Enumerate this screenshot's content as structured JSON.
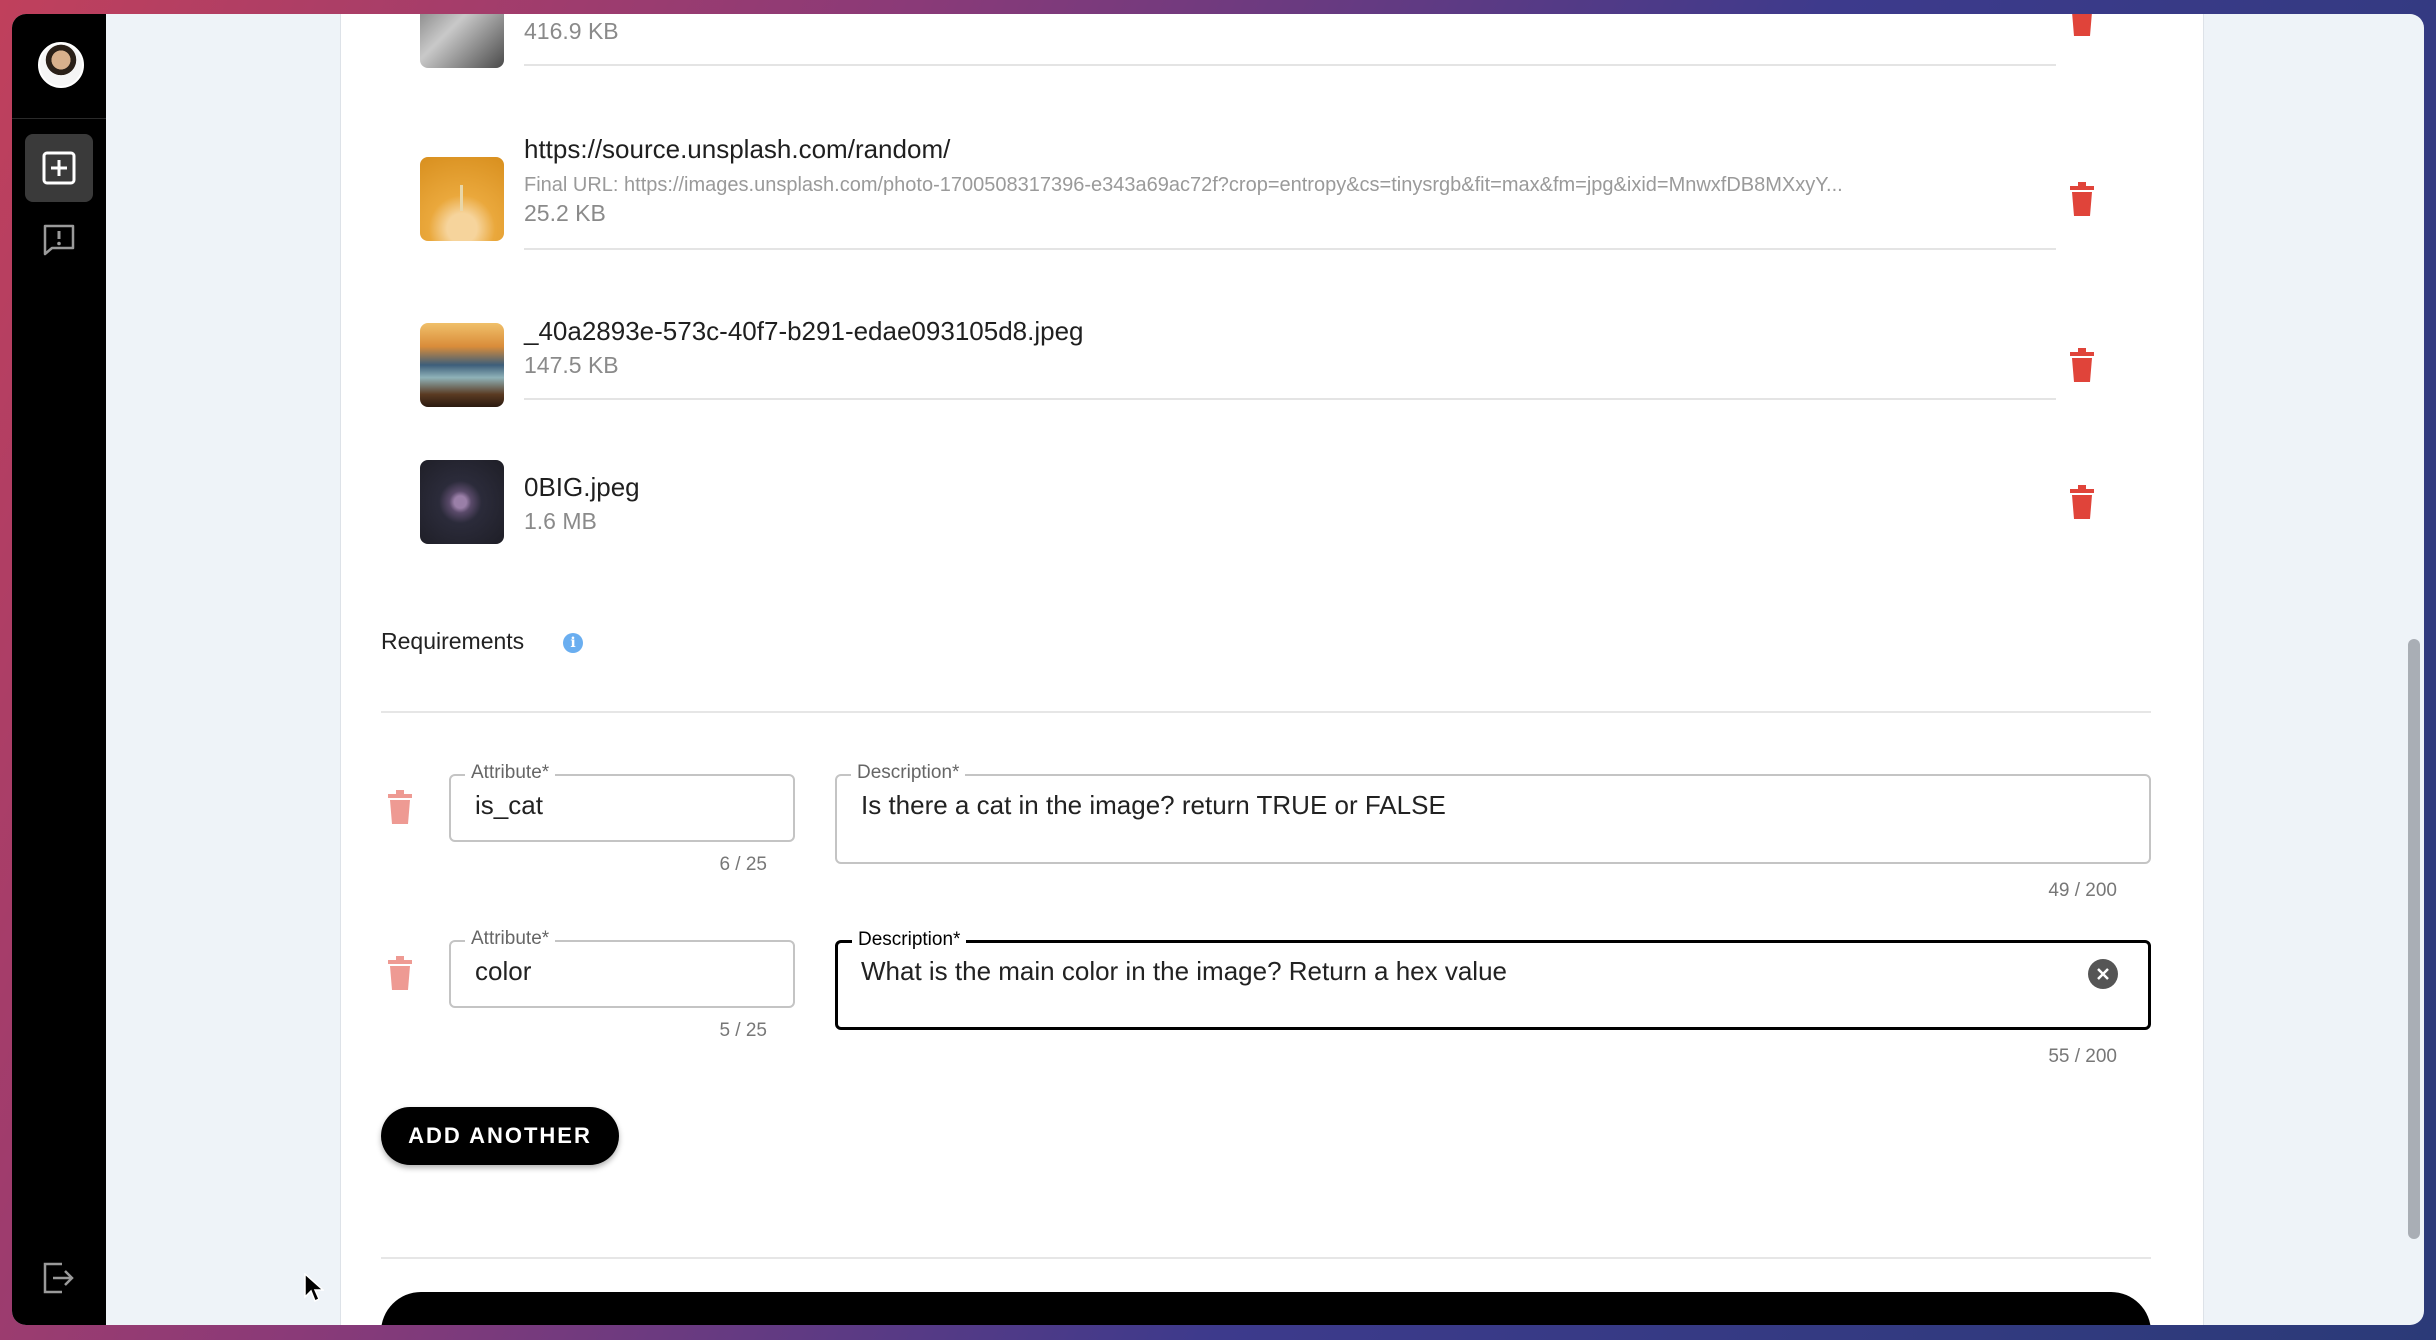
{
  "files": [
    {
      "name": "",
      "size": "416.9 KB"
    },
    {
      "name": "https://source.unsplash.com/random/",
      "final_url": "Final URL: https://images.unsplash.com/photo-1700508317396-e343a69ac72f?crop=entropy&cs=tinysrgb&fit=max&fm=jpg&ixid=MnwxfDB8MXxyY...",
      "size": "25.2 KB"
    },
    {
      "name": "_40a2893e-573c-40f7-b291-edae093105d8.jpeg",
      "size": "147.5 KB"
    },
    {
      "name": "0BIG.jpeg",
      "size": "1.6 MB"
    }
  ],
  "requirements": {
    "title": "Requirements",
    "items": [
      {
        "attribute_label": "Attribute*",
        "attribute": "is_cat",
        "attribute_count": "6 / 25",
        "description_label": "Description*",
        "description": "Is there a cat in the image? return TRUE or FALSE",
        "description_count": "49 / 200"
      },
      {
        "attribute_label": "Attribute*",
        "attribute": "color",
        "attribute_count": "5 / 25",
        "description_label": "Description*",
        "description": "What is the main color in the image? Return a hex value",
        "description_count": "55 / 200"
      }
    ],
    "add_label": "ADD ANOTHER"
  },
  "colors": {
    "delete": "#e0443a",
    "delete_faded": "#ee9a93",
    "info": "#6aaef0"
  },
  "icons": [
    "add-square-icon",
    "feedback-icon",
    "logout-icon",
    "trash-icon",
    "info-icon",
    "clear-icon"
  ]
}
